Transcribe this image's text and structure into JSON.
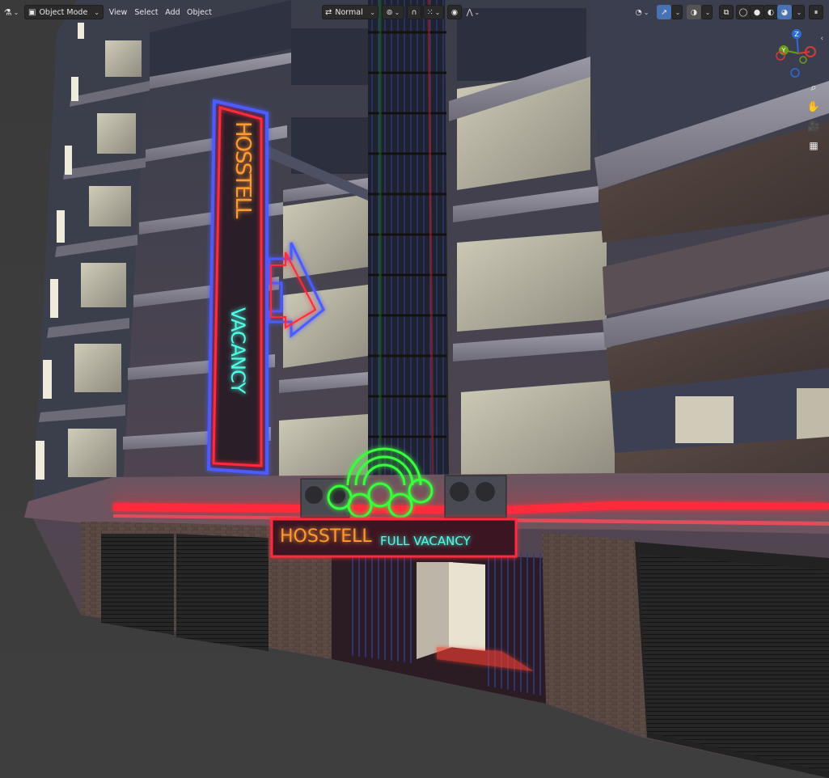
{
  "toolbar": {
    "mode_label": "Object Mode",
    "view_label": "View",
    "select_label": "Select",
    "add_label": "Add",
    "object_label": "Object",
    "orientation_label": "Normal"
  },
  "gizmo": {
    "z_label": "Z",
    "y_label": "Y"
  },
  "sign_vertical": {
    "word1": "HOSSTELL",
    "word2": "VACANCY"
  },
  "sign_entrance": {
    "name": "HOSSTELL",
    "status": "FULL VACANCY"
  },
  "colors": {
    "accent": "#4772b3",
    "neon_red": "#ff2a3a",
    "neon_cyan": "#4dffe6",
    "neon_blue": "#4b5cff",
    "neon_green": "#39ff3a",
    "neon_orange": "#ff9a30"
  },
  "icons": [
    "editor-type-icon",
    "object-mode-icon",
    "transform-orientation-icon",
    "pivot-icon",
    "snap-icon",
    "snap-element-icon",
    "proportional-edit-icon",
    "proportional-falloff-icon",
    "visibility-icon",
    "gizmo-icon",
    "overlay-icon",
    "xray-icon",
    "wireframe-shading-icon",
    "solid-shading-icon",
    "material-preview-icon",
    "rendered-shading-icon",
    "zoom-icon",
    "pan-icon",
    "camera-icon",
    "perspective-grid-icon",
    "collapse-icon"
  ]
}
